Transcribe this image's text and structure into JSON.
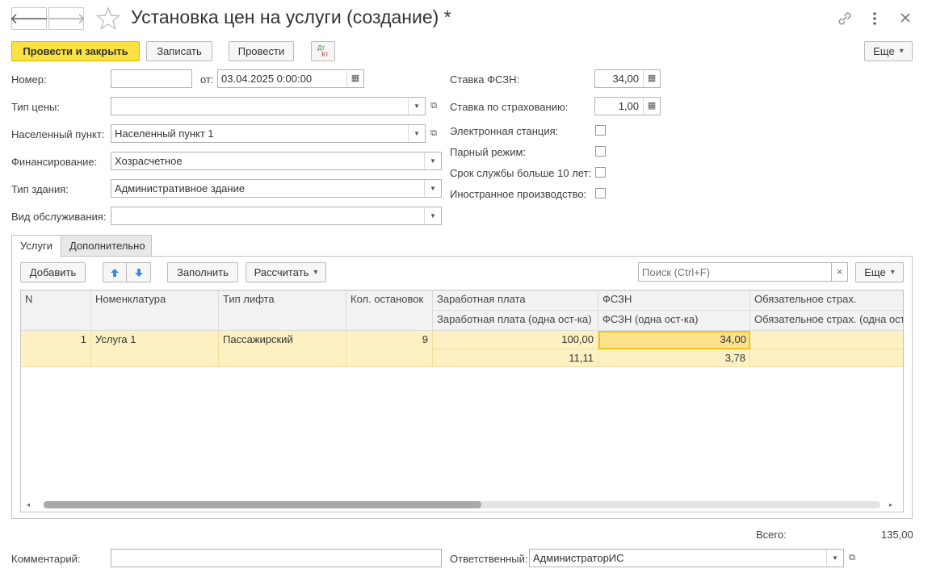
{
  "window": {
    "title": "Установка цен на услуги (создание) *"
  },
  "toolbar": {
    "post_close": "Провести и закрыть",
    "save": "Записать",
    "post": "Провести",
    "dtkt_top": "Дт",
    "dtkt_bottom": "Кт",
    "more": "Еще"
  },
  "form": {
    "number_label": "Номер:",
    "number_value": "",
    "from_label": "от:",
    "date_value": "03.04.2025  0:00:00",
    "price_type_label": "Тип цены:",
    "price_type_value": "",
    "locality_label": "Населенный пункт:",
    "locality_value": "Населенный пункт 1",
    "financing_label": "Финансирование:",
    "financing_value": "Хозрасчетное",
    "building_type_label": "Тип здания:",
    "building_type_value": "Административное здание",
    "service_type_label": "Вид обслуживания:",
    "service_type_value": "",
    "fszn_rate_label": "Ставка ФСЗН:",
    "fszn_rate_value": "34,00",
    "insurance_rate_label": "Ставка по страхованию:",
    "insurance_rate_value": "1,00",
    "electronic_station_label": "Электронная станция:",
    "paired_mode_label": "Парный режим:",
    "service_life_label": "Срок службы больше 10 лет:",
    "foreign_production_label": "Иностранное производство:",
    "checkboxes": {
      "electronic_station": false,
      "paired_mode": false,
      "service_life": false,
      "foreign_production": false
    }
  },
  "tabs": [
    {
      "label": "Услуги",
      "active": true
    },
    {
      "label": "Дополнительно",
      "active": false
    }
  ],
  "table_toolbar": {
    "add": "Добавить",
    "fill": "Заполнить",
    "calculate": "Рассчитать",
    "search_placeholder": "Поиск (Ctrl+F)",
    "clear": "×",
    "more": "Еще"
  },
  "table": {
    "headers_top": [
      "N",
      "Номенклатура",
      "Тип лифта",
      "Кол. остановок",
      "Заработная плата",
      "ФСЗН",
      "Обязательное страх."
    ],
    "headers_bottom": [
      "Заработная плата (одна ост-ка)",
      "ФСЗН (одна ост-ка)",
      "Обязательное страх. (одна ост-ка)"
    ],
    "rows": [
      {
        "n": "1",
        "nomenclature": "Услуга 1",
        "lift_type": "Пассажирский",
        "stops": "9",
        "salary": "100,00",
        "salary_per_stop": "11,11",
        "fszn": "34,00",
        "fszn_per_stop": "3,78",
        "insurance": "",
        "insurance_per_stop": ""
      }
    ]
  },
  "footer": {
    "total_label": "Всего:",
    "total_value": "135,00",
    "comment_label": "Комментарий:",
    "comment_value": "",
    "responsible_label": "Ответственный:",
    "responsible_value": "АдминистраторИС"
  },
  "colors": {
    "primary_button": "#fbe142",
    "row_highlight": "#fdf1c4",
    "selected_cell": "#fbe28e"
  }
}
